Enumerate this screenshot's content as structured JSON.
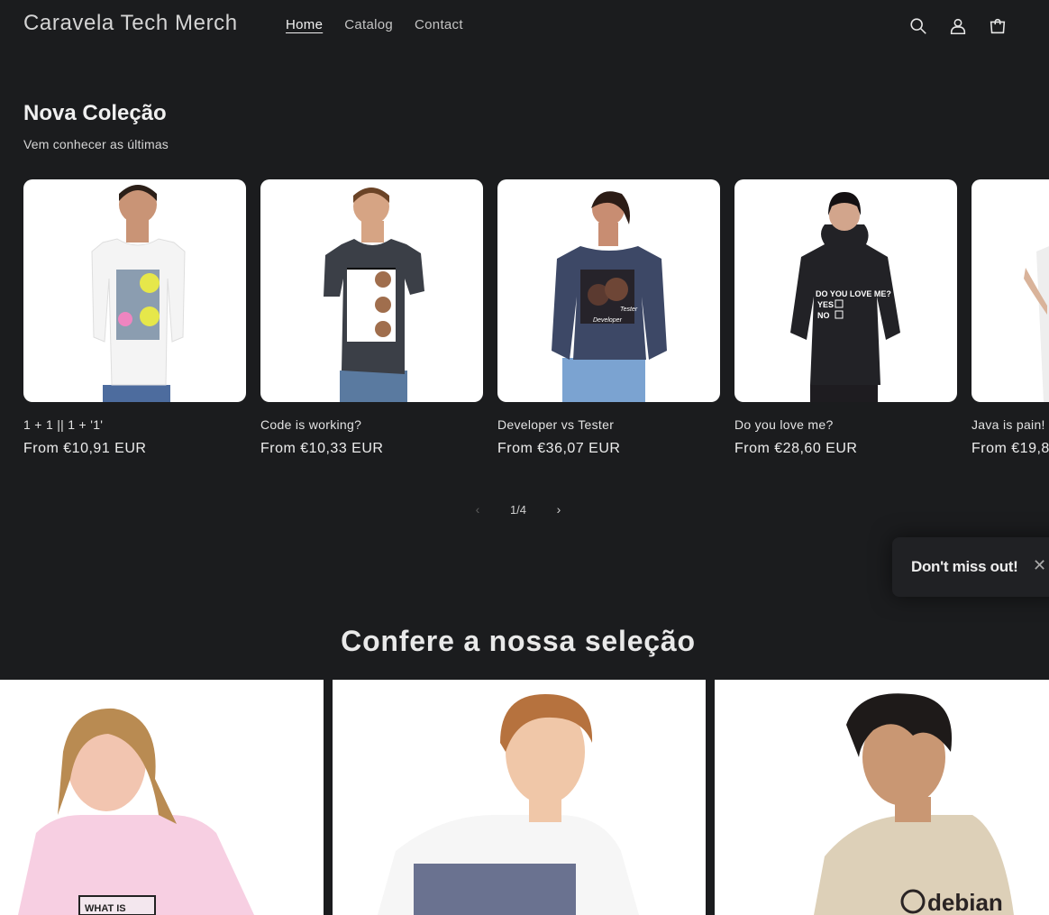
{
  "header": {
    "logo": "Caravela Tech Merch",
    "nav": [
      {
        "label": "Home",
        "active": true
      },
      {
        "label": "Catalog",
        "active": false
      },
      {
        "label": "Contact",
        "active": false
      }
    ],
    "icons": [
      "search-icon",
      "account-icon",
      "cart-icon"
    ]
  },
  "collection": {
    "title": "Nova Coleção",
    "subtitle": "Vem conhecer as últimas",
    "products": [
      {
        "name": "1 + 1 || 1 + '1'",
        "price": "From €10,91 EUR"
      },
      {
        "name": "Code is working?",
        "price": "From €10,33 EUR"
      },
      {
        "name": "Developer vs Tester",
        "price": "From €36,07 EUR"
      },
      {
        "name": "Do you love me?",
        "price": "From €28,60 EUR"
      },
      {
        "name": "Java is pain!",
        "price": "From €19,8"
      }
    ],
    "pagination": {
      "label": "1/4",
      "prev": "‹",
      "next": "›"
    }
  },
  "popup": {
    "text": "Don't miss out!",
    "close": "✕"
  },
  "selection": {
    "title": "Confere a nossa seleção",
    "tile_prints": [
      "WHAT IS",
      "debian"
    ]
  },
  "shirt_prints": {
    "hoodie_line1": "DO YOU LOVE ME?",
    "hoodie_yes": "YES",
    "hoodie_no": "NO",
    "dev_label": "Developer",
    "tester_label": "Tester"
  },
  "colors": {
    "background": "#1b1c1e",
    "card_background": "#ffffff",
    "text": "#e9e9e9"
  }
}
